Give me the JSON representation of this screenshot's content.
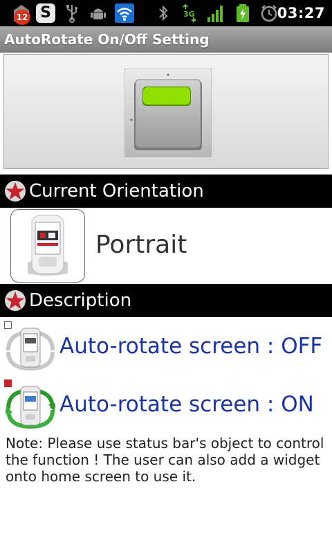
{
  "status_bar": {
    "notification_count": "12",
    "s_app_letter": "S",
    "time": "03:27",
    "network_label": "3G",
    "icons": [
      "app-notification-icon",
      "s-app-icon",
      "usb-icon",
      "android-debug-icon",
      "wifi-icon",
      "bluetooth-icon",
      "3g-data-icon",
      "signal-icon",
      "battery-charging-icon",
      "alarm-icon"
    ]
  },
  "title_bar": {
    "title": "AutoRotate On/Off Setting"
  },
  "toggle": {
    "state_color": "#8fe000",
    "icon": "toggle-switch-icon"
  },
  "orientation_section": {
    "header": "Current Orientation",
    "value": "Portrait",
    "icon": "portrait-phone-icon"
  },
  "description_section": {
    "header": "Description",
    "rows": [
      {
        "text": "Auto-rotate screen : OFF",
        "checked": false,
        "icon": "rotate-off-icon"
      },
      {
        "text": "Auto-rotate screen : ON",
        "checked": true,
        "icon": "rotate-on-icon"
      }
    ],
    "note": "Note: Please use status bar's object to control the function ! The user can also add a widget onto home screen to use it."
  },
  "colors": {
    "accent_red": "#c8232c",
    "link_blue": "#1a33a6",
    "toggle_green": "#8fe000"
  }
}
